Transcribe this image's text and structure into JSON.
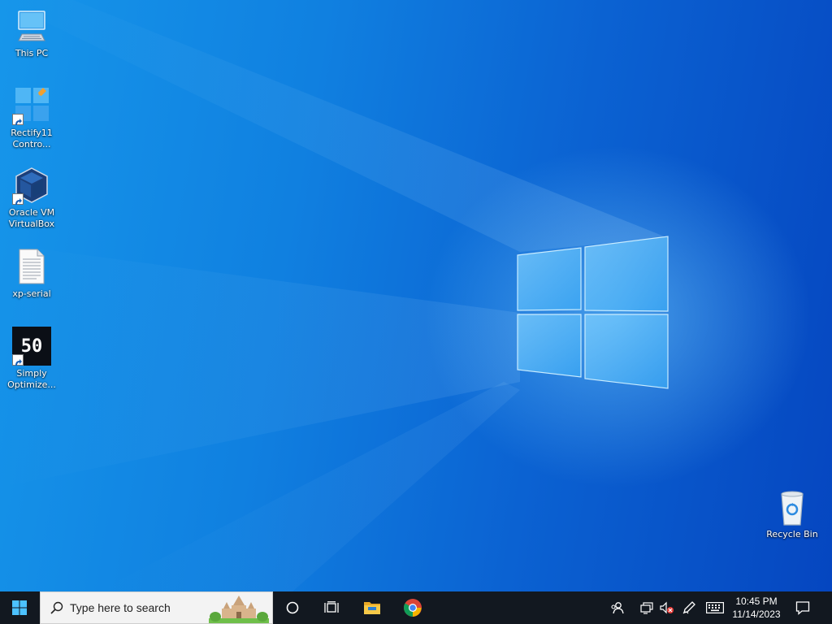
{
  "desktop": {
    "icons": [
      {
        "id": "this-pc",
        "label": "This PC",
        "icon": "computer-icon"
      },
      {
        "id": "rectify11",
        "label": "Rectify11\nContro...",
        "icon": "windows-tiles-icon"
      },
      {
        "id": "virtualbox",
        "label": "Oracle VM\nVirtualBox",
        "icon": "virtualbox-icon"
      },
      {
        "id": "xp-serial",
        "label": "xp-serial",
        "icon": "text-document-icon"
      },
      {
        "id": "simply-optimize",
        "label": "Simply\nOptimize...",
        "icon": "optimizer-icon",
        "glyph": "50"
      },
      {
        "id": "recycle-bin",
        "label": "Recycle Bin",
        "icon": "recycle-bin-icon"
      }
    ]
  },
  "taskbar": {
    "start_icon": "windows-logo-icon",
    "search": {
      "placeholder": "Type here to search",
      "icon": "search-icon",
      "highlight_icon": "temple-highlight-icon"
    },
    "cortana_icon": "cortana-circle-icon",
    "taskview_icon": "task-view-icon",
    "pinned": [
      {
        "id": "file-explorer",
        "icon": "folder-icon"
      },
      {
        "id": "chrome",
        "icon": "chrome-icon"
      }
    ],
    "tray": {
      "people_icon": "people-icon",
      "network_icon": "network-icon",
      "volume_icon": "volume-muted-icon",
      "pen_icon": "pen-icon",
      "keyboard_icon": "keyboard-icon",
      "time": "10:45 PM",
      "date": "11/14/2023",
      "notification_icon": "action-center-icon"
    }
  },
  "colors": {
    "taskbar_bg": "#121820",
    "wallpaper_light": "#1696ea",
    "wallpaper_dark": "#0546c0"
  }
}
